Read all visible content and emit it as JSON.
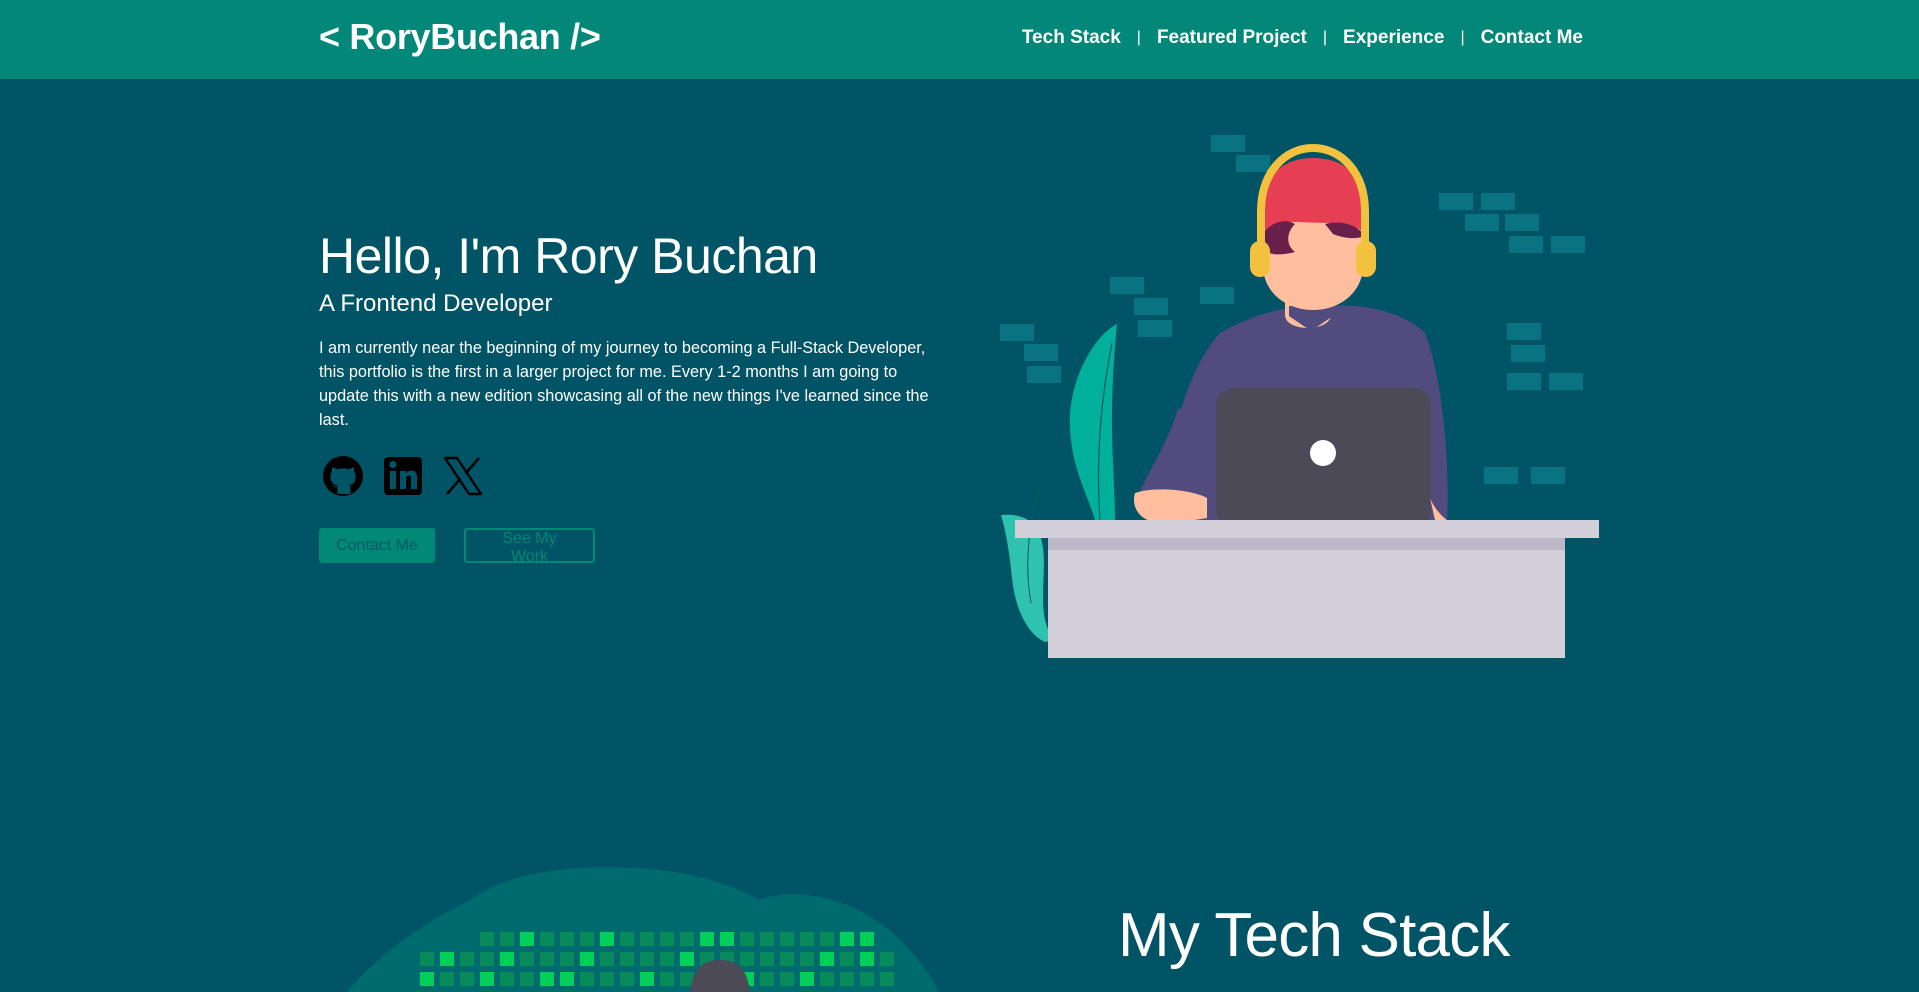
{
  "navbar": {
    "brand": "< RoryBuchan />",
    "links": [
      {
        "label": "Tech Stack"
      },
      {
        "label": "Featured Project"
      },
      {
        "label": "Experience"
      },
      {
        "label": "Contact Me"
      }
    ],
    "separator": "|"
  },
  "hero": {
    "title": "Hello, I'm Rory Buchan",
    "subtitle": "A Frontend Developer",
    "description": "I am currently near the beginning of my journey to becoming a Full-Stack Developer, this portfolio is the first in a larger project for me. Every 1-2 months I am going to update this with a new edition showcasing all of the new things I've learned since the last.",
    "socials": [
      {
        "icon": "github-icon"
      },
      {
        "icon": "linkedin-icon"
      },
      {
        "icon": "x-icon"
      }
    ],
    "primary_button": "Contact Me",
    "secondary_button": "See My Work"
  },
  "tech_stack": {
    "title": "My Tech Stack"
  },
  "colors": {
    "background": "#005466",
    "navbar": "#028779",
    "accent": "#018876",
    "cap": "#E63E52",
    "headphones": "#F2C13E",
    "shirt": "#514C7D",
    "laptop": "#4C4A56",
    "desk": "#D3D0DC",
    "plant": "#00B09A"
  }
}
